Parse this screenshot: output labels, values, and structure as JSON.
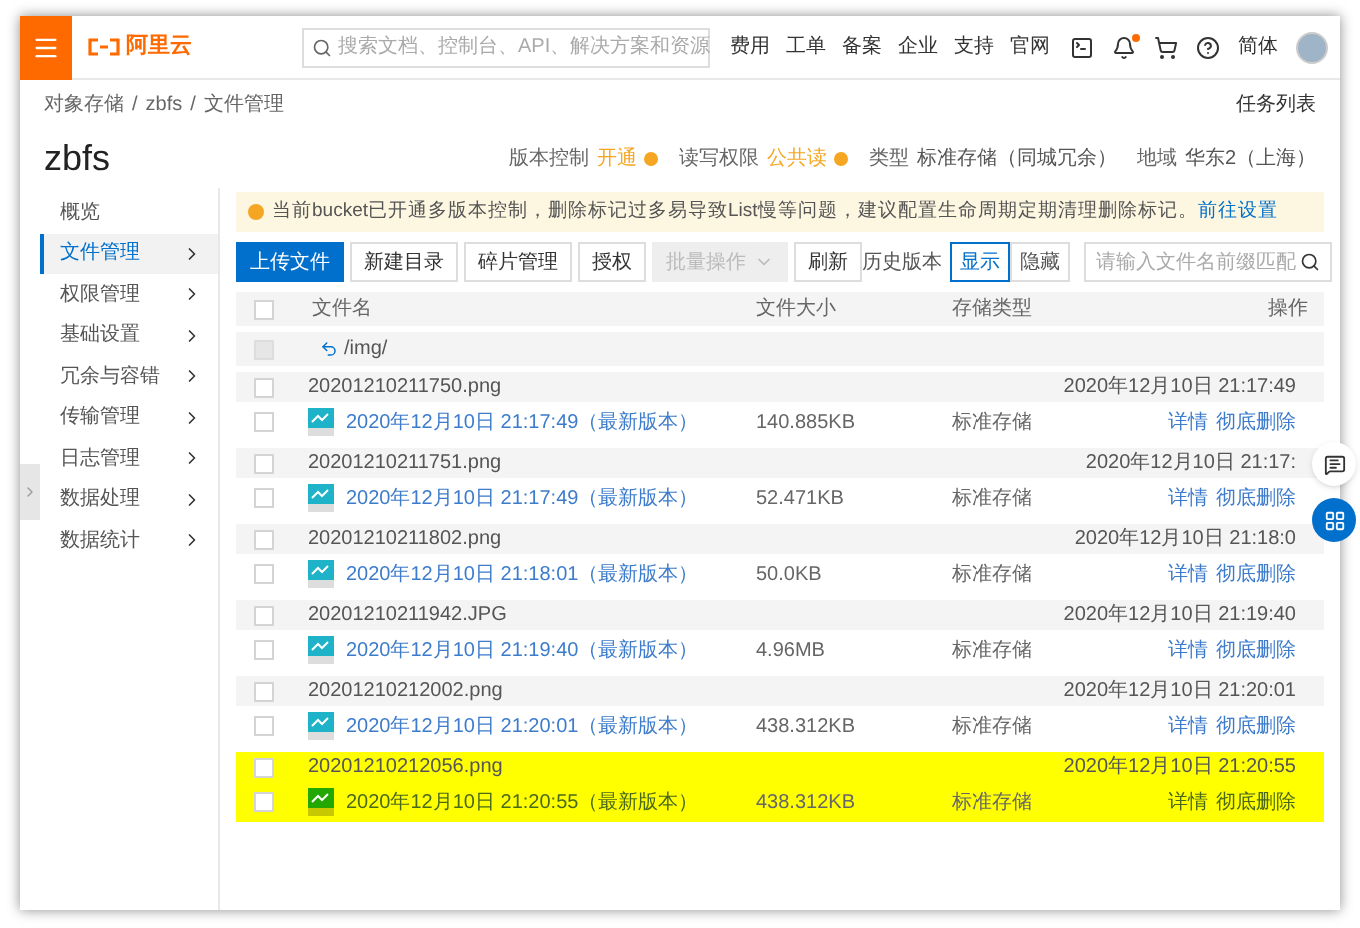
{
  "header": {
    "logo": "阿里云",
    "search": {
      "placeholder": "搜索文档、控制台、API、解决方案和资源"
    },
    "nav": [
      "费用",
      "工单",
      "备案",
      "企业",
      "支持",
      "官网"
    ],
    "notification_dot": true,
    "language": "简体"
  },
  "breadcrumb": {
    "items": [
      "对象存储",
      "zbfs",
      "文件管理"
    ],
    "separator": "/"
  },
  "task_list": "任务列表",
  "bucket": {
    "title": "zbfs",
    "properties": [
      {
        "label": "版本控制",
        "value": "开通",
        "kind": "warning"
      },
      {
        "label": "读写权限",
        "value": "公共读",
        "kind": "warning"
      },
      {
        "label": "类型",
        "value": "标准存储（同城冗余）",
        "kind": "plain"
      },
      {
        "label": "地域",
        "value": "华东2（上海）",
        "kind": "plain"
      }
    ]
  },
  "sidebar": {
    "items": [
      {
        "label": "概览",
        "selected": false,
        "expandable": false
      },
      {
        "label": "文件管理",
        "selected": true,
        "expandable": true
      },
      {
        "label": "权限管理",
        "selected": false,
        "expandable": true
      },
      {
        "label": "基础设置",
        "selected": false,
        "expandable": true
      },
      {
        "label": "冗余与容错",
        "selected": false,
        "expandable": true
      },
      {
        "label": "传输管理",
        "selected": false,
        "expandable": true
      },
      {
        "label": "日志管理",
        "selected": false,
        "expandable": true
      },
      {
        "label": "数据处理",
        "selected": false,
        "expandable": true
      },
      {
        "label": "数据统计",
        "selected": false,
        "expandable": true
      }
    ]
  },
  "notice": {
    "text": "当前bucket已开通多版本控制，删除标记过多易导致List慢等问题，建议配置生命周期定期清理删除标记。",
    "link": "前往设置"
  },
  "toolbar": {
    "buttons": [
      {
        "label": "上传文件",
        "kind": "primary"
      },
      {
        "label": "新建目录",
        "kind": "default"
      },
      {
        "label": "碎片管理",
        "kind": "default"
      },
      {
        "label": "授权",
        "kind": "default"
      },
      {
        "label": "批量操作",
        "kind": "dropdown",
        "disabled": true
      },
      {
        "label": "刷新",
        "kind": "default"
      }
    ],
    "history": {
      "label": "历史版本",
      "options": [
        {
          "label": "显示",
          "selected": true
        },
        {
          "label": "隐藏",
          "selected": false
        }
      ]
    },
    "search": {
      "placeholder": "请输入文件名前缀匹配"
    }
  },
  "table": {
    "columns": [
      "文件名",
      "文件大小",
      "存储类型",
      "操作"
    ],
    "select_all": {
      "checked": false
    },
    "folder": {
      "path": "/img/",
      "disabled": true
    },
    "groups": [
      {
        "name": "20201210211750.png",
        "time": "2020年12月10日 21:17:49",
        "highlighted": false,
        "version": {
          "label": "2020年12月10日 21:17:49（最新版本）",
          "size": "140.885KB",
          "storage": "标准存储",
          "actions": [
            "详情",
            "彻底删除"
          ]
        }
      },
      {
        "name": "20201210211751.png",
        "time": "2020年12月10日 21:17:",
        "highlighted": false,
        "version": {
          "label": "2020年12月10日 21:17:49（最新版本）",
          "size": "52.471KB",
          "storage": "标准存储",
          "actions": [
            "详情",
            "彻底删除"
          ]
        }
      },
      {
        "name": "20201210211802.png",
        "time": "2020年12月10日 21:18:0",
        "highlighted": false,
        "version": {
          "label": "2020年12月10日 21:18:01（最新版本）",
          "size": "50.0KB",
          "storage": "标准存储",
          "actions": [
            "详情",
            "彻底删除"
          ]
        }
      },
      {
        "name": "20201210211942.JPG",
        "time": "2020年12月10日 21:19:40",
        "highlighted": false,
        "version": {
          "label": "2020年12月10日 21:19:40（最新版本）",
          "size": "4.96MB",
          "storage": "标准存储",
          "actions": [
            "详情",
            "彻底删除"
          ]
        }
      },
      {
        "name": "20201210212002.png",
        "time": "2020年12月10日 21:20:01",
        "highlighted": false,
        "version": {
          "label": "2020年12月10日 21:20:01（最新版本）",
          "size": "438.312KB",
          "storage": "标准存储",
          "actions": [
            "详情",
            "彻底删除"
          ]
        }
      },
      {
        "name": "20201210212056.png",
        "time": "2020年12月10日 21:20:55",
        "highlighted": true,
        "version": {
          "label": "2020年12月10日 21:20:55（最新版本）",
          "size": "438.312KB",
          "storage": "标准存储",
          "actions": [
            "详情",
            "彻底删除"
          ]
        }
      }
    ]
  }
}
